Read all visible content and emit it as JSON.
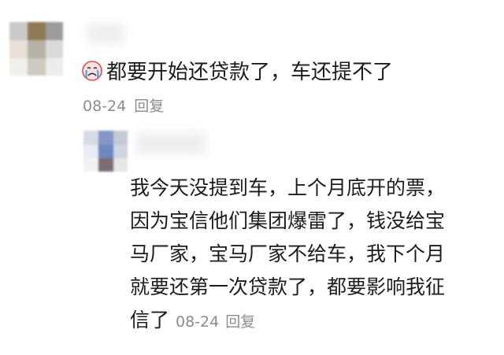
{
  "comment": {
    "emoji_icon": "crying-face-icon",
    "text": "都要开始还贷款了，车还提不了",
    "date": "08-24",
    "reply_label": "回复"
  },
  "reply": {
    "lines": [
      "我今天没提到车，上个月底开的票，",
      "因为宝信他们集团爆雷了，钱没给宝",
      "马厂家，宝马厂家不给车，我下个月",
      "就要还第一次贷款了，都要影响我征",
      "信了"
    ],
    "date": "08-24",
    "reply_label": "回复"
  },
  "colors": {
    "text": "#1c1c1c",
    "meta": "#8c8c8c",
    "background": "#ffffff"
  }
}
